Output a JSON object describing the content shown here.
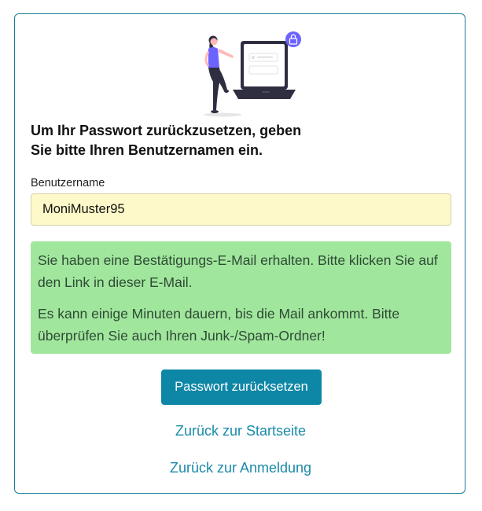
{
  "form": {
    "heading_line1": "Um Ihr Passwort zurückzusetzen, geben",
    "heading_line2": "Sie bitte Ihren Benutzernamen ein.",
    "username_label": "Benutzername",
    "username_value": "MoniMuster95"
  },
  "alert": {
    "message1": "Sie haben eine Bestätigungs-E-Mail erhalten. Bitte klicken Sie auf den Link in dieser E-Mail.",
    "message2": "Es kann einige Minuten dauern, bis die Mail ankommt. Bitte überprüfen Sie auch Ihren Junk-/Spam-Ordner!",
    "background_color": "#a1e69d"
  },
  "actions": {
    "reset_button_label": "Passwort zurücksetzen",
    "home_link_label": "Zurück zur Startseite",
    "login_link_label": "Zurück zur Anmeldung"
  },
  "illustration": {
    "icon": "lock-icon",
    "description_icon": "person-with-laptop-illustration"
  },
  "colors": {
    "accent": "#0e86a6",
    "link": "#1a8aa8",
    "input_background": "#fef9c8",
    "illustration_purple": "#6c63ff"
  }
}
